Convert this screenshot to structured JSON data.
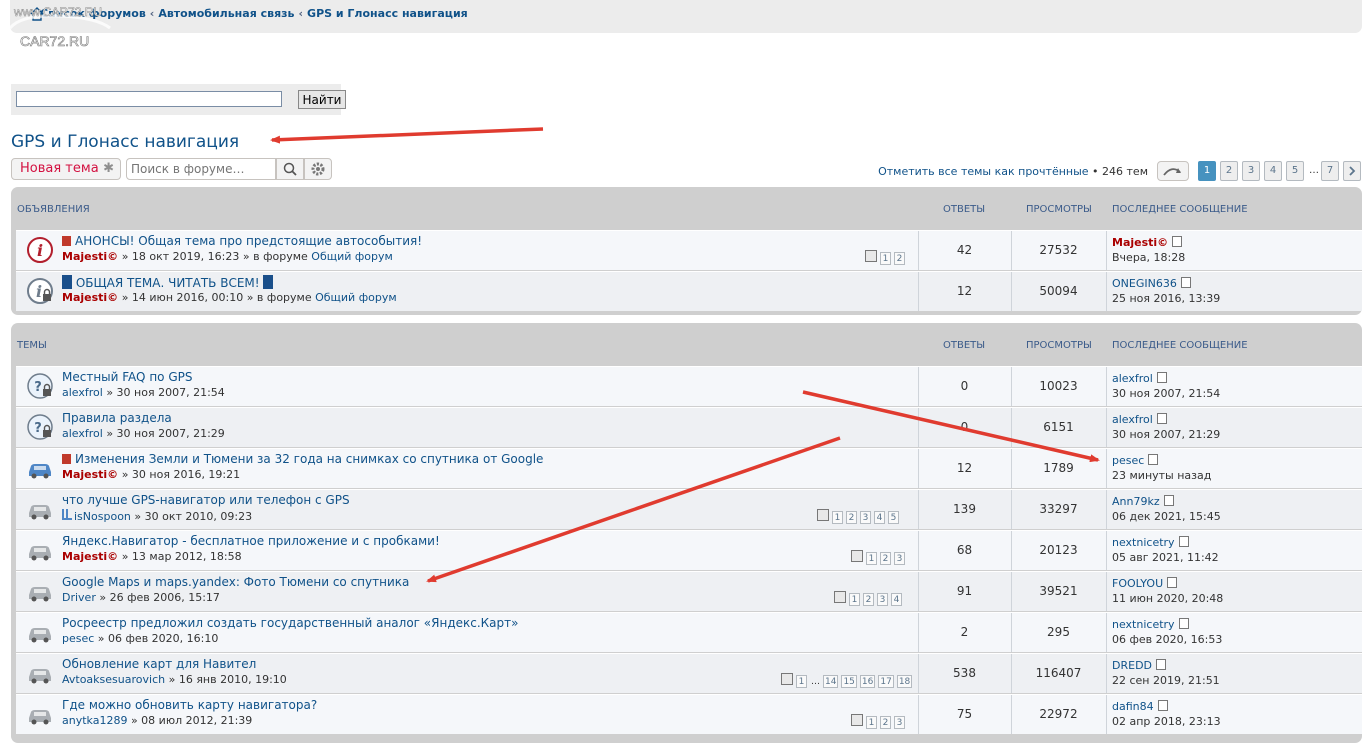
{
  "watermark": {
    "line1": "www.CAR72.RU",
    "line2": "CAR72.RU"
  },
  "breadcrumbs": [
    "Список форумов",
    "Автомобильная связь",
    "GPS и Глонасс навигация"
  ],
  "breadcrumb_sep": "‹",
  "search": {
    "value": "",
    "button": "Найти"
  },
  "forum_title": "GPS и Глонасс навигация",
  "actions": {
    "new_topic": "Новая тема",
    "forum_search_placeholder": "Поиск в форуме…",
    "mark_read": "Отметить все темы как прочтённые",
    "topic_count": "• 246 тем"
  },
  "pagination": {
    "pages": [
      "1",
      "2",
      "3",
      "4",
      "5",
      "7"
    ],
    "ellipsis": "…",
    "active": "1"
  },
  "announcements": {
    "header": {
      "title": "Объявления",
      "replies": "Ответы",
      "views": "Просмотры",
      "last": "Последнее сообщение"
    },
    "rows": [
      {
        "title": "АНОНСЫ! Общая тема про предстоящие автособытия!",
        "author": "Majesti©",
        "date": "» 18 окт 2019, 16:23",
        "in_forum": "» в форуме",
        "forum": "Общий форум",
        "replies": "42",
        "views": "27532",
        "last_user": "Majesti©",
        "last_time": "Вчера, 18:28",
        "pages": [
          "1",
          "2"
        ]
      },
      {
        "title": "ОБЩАЯ ТЕМА. ЧИТАТЬ ВСЕМ!",
        "author": "Majesti©",
        "date": "» 14 июн 2016, 00:10",
        "in_forum": "» в форуме",
        "forum": "Общий форум",
        "replies": "12",
        "views": "50094",
        "last_user": "ONEGIN636",
        "last_time": "25 ноя 2016, 13:39",
        "pages": []
      }
    ]
  },
  "topics": {
    "header": {
      "title": "Темы",
      "replies": "Ответы",
      "views": "Просмотры",
      "last": "Последнее сообщение"
    },
    "rows": [
      {
        "title": "Местный FAQ по GPS",
        "author": "alexfrol",
        "date": "» 30 ноя 2007, 21:54",
        "replies": "0",
        "views": "10023",
        "last_user": "alexfrol",
        "last_time": "30 ноя 2007, 21:54"
      },
      {
        "title": "Правила раздела",
        "author": "alexfrol",
        "date": "» 30 ноя 2007, 21:29",
        "replies": "0",
        "views": "6151",
        "last_user": "alexfrol",
        "last_time": "30 ноя 2007, 21:29"
      },
      {
        "title": "Изменения Земли и Тюмени за 32 года на снимках со спутника от Google",
        "author": "Majesti©",
        "date": "» 30 ноя 2016, 19:21",
        "replies": "12",
        "views": "1789",
        "last_user": "pesec",
        "last_time": "23 минуты назад"
      },
      {
        "title": "что лучше GPS-навигатор или телефон с GPS",
        "author": "isNospoon",
        "date": "» 30 окт 2010, 09:23",
        "replies": "139",
        "views": "33297",
        "last_user": "Ann79kz",
        "last_time": "06 дек 2021, 15:45",
        "pages": [
          "1",
          "2",
          "3",
          "4",
          "5"
        ]
      },
      {
        "title": "Яндекс.Навигатор - бесплатное приложение и с пробками!",
        "author": "Majesti©",
        "date": "» 13 мар 2012, 18:58",
        "replies": "68",
        "views": "20123",
        "last_user": "nextnicetry",
        "last_time": "05 авг 2021, 11:42",
        "pages": [
          "1",
          "2",
          "3"
        ]
      },
      {
        "title": "Google Maps и maps.yandex: Фото Тюмени со спутника",
        "author": "Driver",
        "date": "» 26 фев 2006, 15:17",
        "replies": "91",
        "views": "39521",
        "last_user": "FOOLYOU",
        "last_time": "11 июн 2020, 20:48",
        "pages": [
          "1",
          "2",
          "3",
          "4"
        ]
      },
      {
        "title": "Росреестр предложил создать государственный аналог «Яндекс.Карт»",
        "author": "pesec",
        "date": "» 06 фев 2020, 16:10",
        "replies": "2",
        "views": "295",
        "last_user": "nextnicetry",
        "last_time": "06 фев 2020, 16:53"
      },
      {
        "title": "Обновление карт для Навител",
        "author": "Avtoaksesuarovich",
        "date": "» 16 янв 2010, 19:10",
        "replies": "538",
        "views": "116407",
        "last_user": "DREDD",
        "last_time": "22 сен 2019, 21:51",
        "pages": [
          "1",
          "…",
          "14",
          "15",
          "16",
          "17",
          "18"
        ]
      },
      {
        "title": "Где можно обновить карту навигатора?",
        "author": "anytka1289",
        "date": "» 08 июл 2012, 21:39",
        "replies": "75",
        "views": "22972",
        "last_user": "dafin84",
        "last_time": "02 апр 2018, 23:13",
        "pages": [
          "1",
          "2",
          "3"
        ]
      }
    ]
  },
  "colors": {
    "link": "#105289",
    "admin": "#aa0000",
    "arrow": "#e03b2f",
    "accent_page": "#4692bf"
  }
}
